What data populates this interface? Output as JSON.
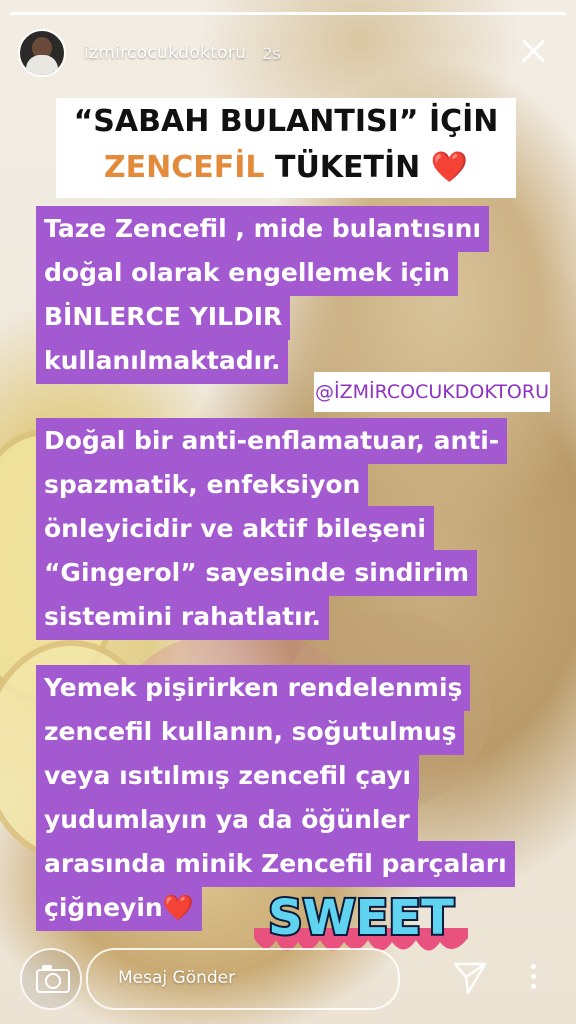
{
  "story": {
    "progress": 1.0,
    "username": "izmircocukdoktoru",
    "time_ago": "2s"
  },
  "title": {
    "line1": "“SABAH BULANTISI” İÇİN",
    "highlight": "ZENCEFİL",
    "line2_rest": "TÜKETİN",
    "emoji": "❤️"
  },
  "paragraph1": [
    "Taze Zencefil , mide bulantısını",
    "doğal olarak engellemek için",
    "BİNLERCE YILDIR",
    "kullanılmaktadır."
  ],
  "handle": "@İZMİRCOCUKDOKTORU",
  "paragraph2": [
    "Doğal bir anti-enflamatuar, anti-",
    "spazmatik, enfeksiyon",
    "önleyicidir ve aktif bileşeni",
    "“Gingerol” sayesinde sindirim",
    "sistemini rahatlatır."
  ],
  "paragraph3": [
    "Yemek pişirirken rendelenmiş",
    "zencefil kullanın, soğutulmuş",
    "veya ısıtılmış zencefil çayı",
    "yudumlayın ya da öğünler",
    "arasında minik Zencefil parçaları",
    "çiğneyin❤️"
  ],
  "sticker": "SWEET",
  "bottom": {
    "message_placeholder": "Mesaj Gönder",
    "camera_icon": "camera-icon",
    "send_icon": "send-icon",
    "more_icon": "more-vertical-icon"
  },
  "colors": {
    "purple": "#a35ad0",
    "orange": "#e38b3b",
    "heart": "#e53935"
  }
}
